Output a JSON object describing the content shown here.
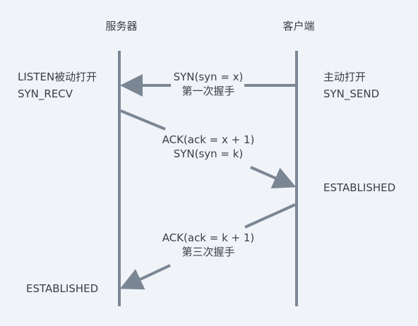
{
  "participants": {
    "server": "服务器",
    "client": "客户端"
  },
  "server_states": {
    "listen": "LISTEN被动打开",
    "syn_recv": "SYN_RECV",
    "established": "ESTABLISHED"
  },
  "client_states": {
    "active_open": "主动打开",
    "syn_send": "SYN_SEND",
    "established": "ESTABLISHED"
  },
  "messages": {
    "first": {
      "line1": "SYN(syn = x)",
      "line2": "第一次握手"
    },
    "second": {
      "line1": "ACK(ack = x + 1)",
      "line2": "SYN(syn = k)"
    },
    "third": {
      "line1": "ACK(ack = k + 1)",
      "line2": "第三次握手"
    }
  },
  "colors": {
    "background": "#f0f3f8",
    "line": "#7b8694",
    "text": "#3a3f47"
  }
}
